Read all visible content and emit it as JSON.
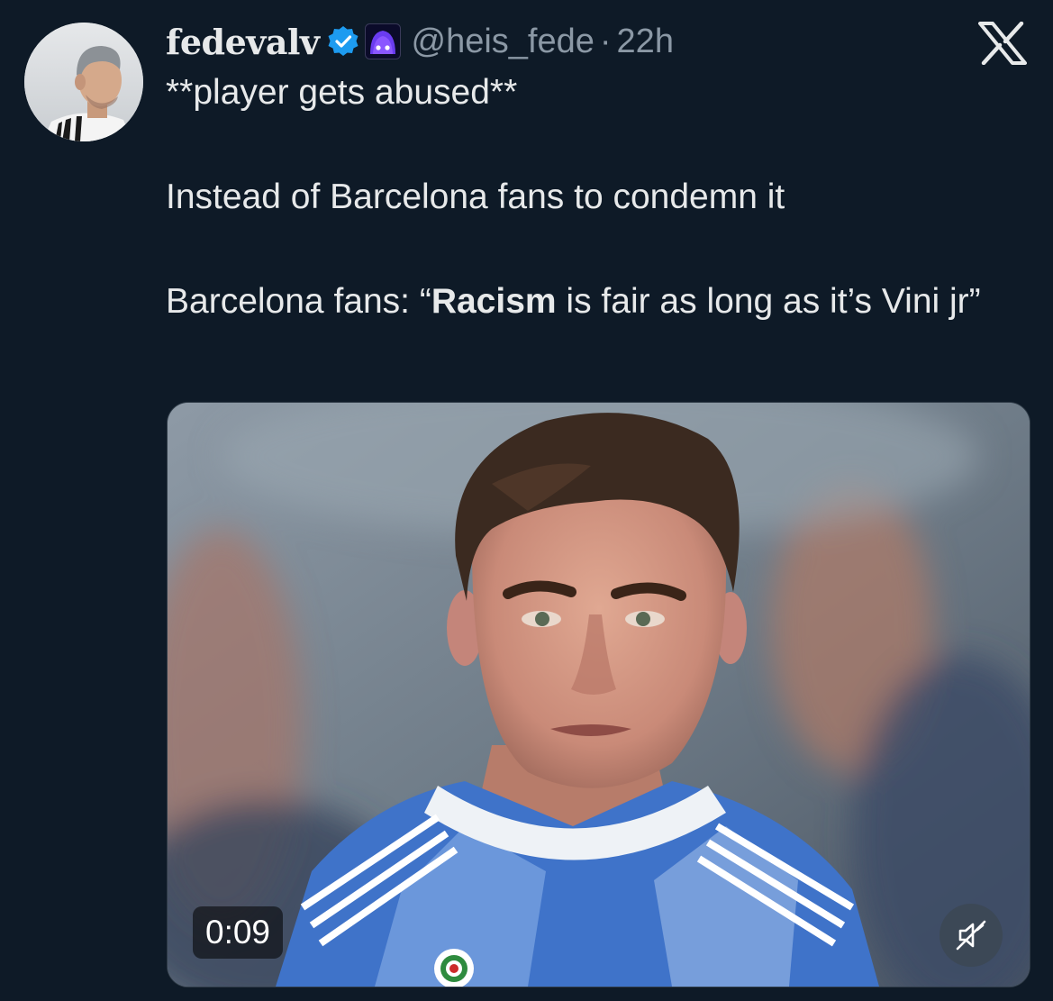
{
  "tweet": {
    "display_name": "fedevalv",
    "handle": "@heis_fede",
    "separator": "·",
    "time": "22h",
    "line1": "**player gets abused**",
    "line2": "Instead of Barcelona fans to condemn it",
    "line3_before": "Barcelona fans: “",
    "line3_bold": "Racism",
    "line3_after": " is fair as long as it’s Vini jr”"
  },
  "icons": {
    "verified": "verified-badge-icon",
    "affiliate": "affiliate-badge-icon",
    "close": "x-logo-icon",
    "mute": "muted-speaker-icon"
  },
  "media": {
    "type": "video",
    "duration": "0:09"
  },
  "colors": {
    "background": "#0e1a27",
    "text": "#e7e9ea",
    "secondary_text": "#8b98a5",
    "verified_blue": "#1d9bf0"
  }
}
